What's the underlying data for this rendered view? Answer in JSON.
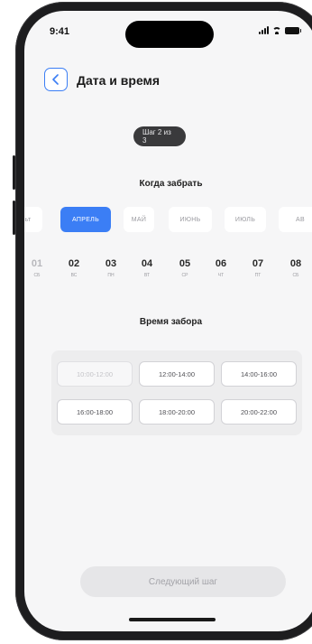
{
  "status_bar": {
    "time": "9:41"
  },
  "header": {
    "title": "Дата и время"
  },
  "step": {
    "label": "Шаг 2 из 3"
  },
  "pickup_date": {
    "title": "Когда забрать",
    "months": [
      "ьт",
      "АПРЕЛЬ",
      "МАЙ",
      "ИЮНЬ",
      "ИЮЛЬ",
      "АВ"
    ],
    "selected_month": "АПРЕЛЬ",
    "days": [
      {
        "num": "01",
        "wd": "СБ"
      },
      {
        "num": "02",
        "wd": "ВС"
      },
      {
        "num": "03",
        "wd": "ПН"
      },
      {
        "num": "04",
        "wd": "ВТ"
      },
      {
        "num": "05",
        "wd": "СР"
      },
      {
        "num": "06",
        "wd": "ЧТ"
      },
      {
        "num": "07",
        "wd": "ПТ"
      },
      {
        "num": "08",
        "wd": "СБ"
      }
    ]
  },
  "pickup_time": {
    "title": "Время забора",
    "slots": [
      "10:00-12:00",
      "12:00-14:00",
      "14:00-16:00",
      "16:00-18:00",
      "18:00-20:00",
      "20:00-22:00"
    ],
    "disabled_slots": [
      "10:00-12:00"
    ]
  },
  "footer": {
    "next_label": "Следующий шаг"
  },
  "colors": {
    "accent": "#3b7ef5",
    "step_pill": "#3a3a3c"
  }
}
